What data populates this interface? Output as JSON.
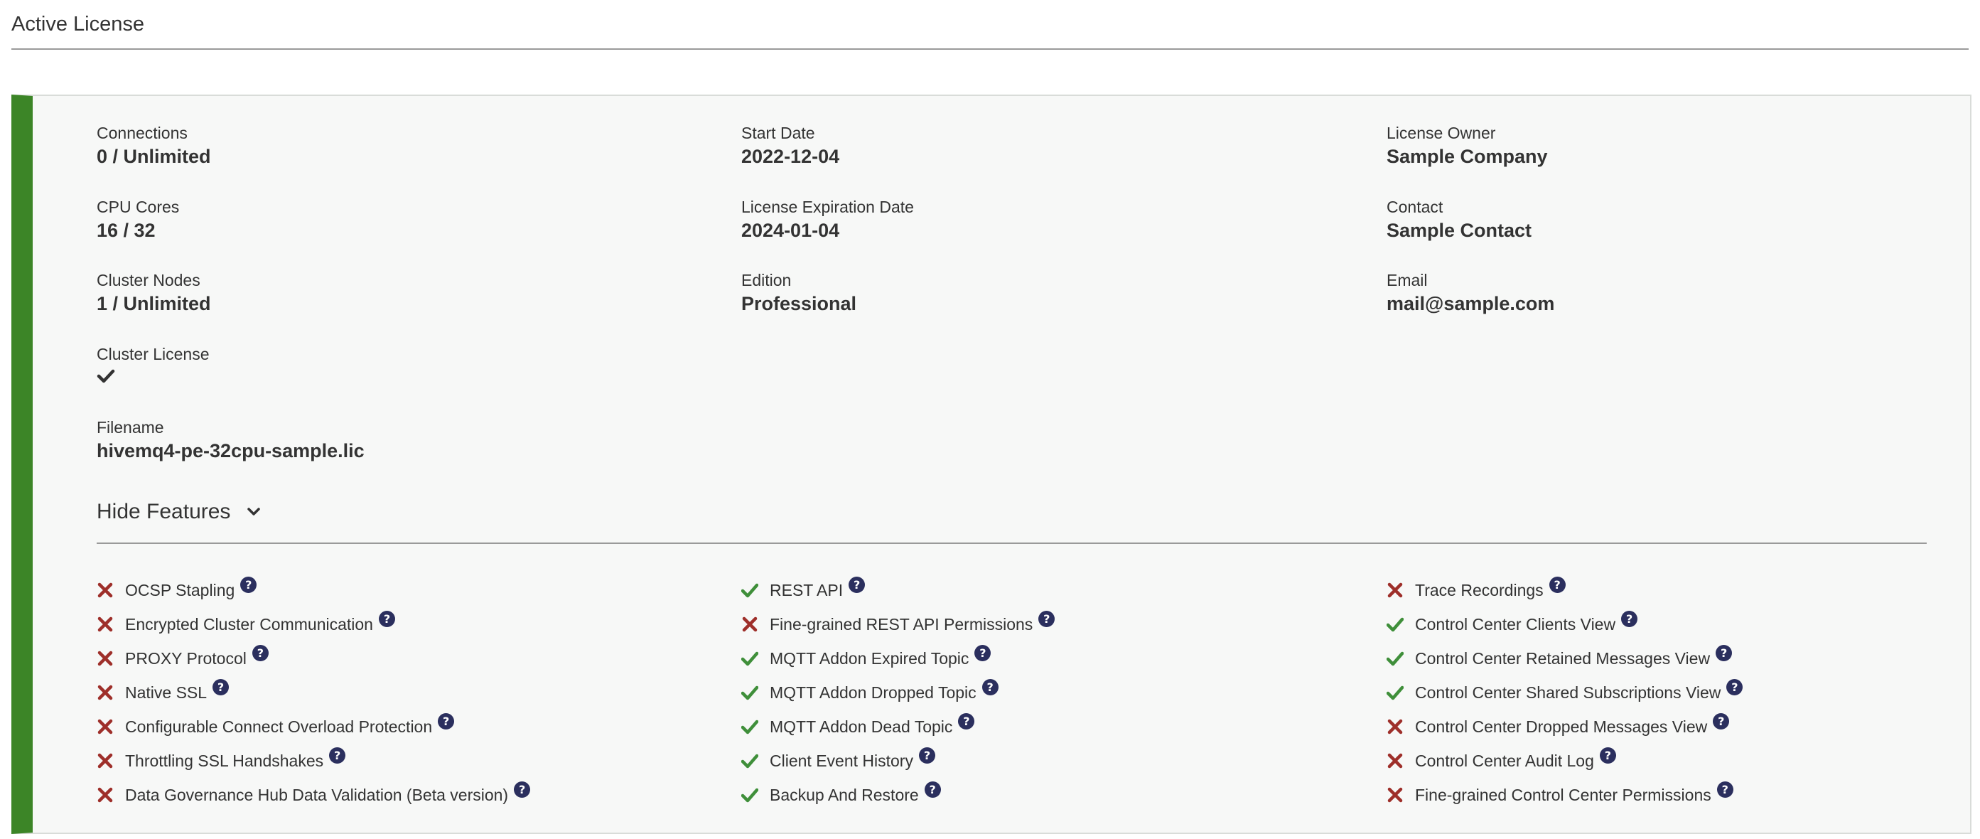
{
  "page": {
    "title": "Active License"
  },
  "license": {
    "col1": [
      {
        "label": "Connections",
        "value": "0 / Unlimited"
      },
      {
        "label": "CPU Cores",
        "value": "16 / 32"
      },
      {
        "label": "Cluster Nodes",
        "value": "1 / Unlimited"
      },
      {
        "label": "Cluster License",
        "value": "check"
      },
      {
        "label": "Filename",
        "value": "hivemq4-pe-32cpu-sample.lic"
      }
    ],
    "col2": [
      {
        "label": "Start Date",
        "value": "2022-12-04"
      },
      {
        "label": "License Expiration Date",
        "value": "2024-01-04"
      },
      {
        "label": "Edition",
        "value": "Professional"
      }
    ],
    "col3": [
      {
        "label": "License Owner",
        "value": "Sample Company"
      },
      {
        "label": "Contact",
        "value": "Sample Contact"
      },
      {
        "label": "Email",
        "value": "mail@sample.com"
      }
    ]
  },
  "features_toggle": {
    "label": "Hide Features",
    "icon": "chevron-down-icon"
  },
  "features": {
    "col1": [
      {
        "name": "OCSP Stapling",
        "enabled": false
      },
      {
        "name": "Encrypted Cluster Communication",
        "enabled": false
      },
      {
        "name": "PROXY Protocol",
        "enabled": false
      },
      {
        "name": "Native SSL",
        "enabled": false
      },
      {
        "name": "Configurable Connect Overload Protection",
        "enabled": false
      },
      {
        "name": "Throttling SSL Handshakes",
        "enabled": false
      },
      {
        "name": "Data Governance Hub Data Validation (Beta version)",
        "enabled": false
      }
    ],
    "col2": [
      {
        "name": "REST API",
        "enabled": true
      },
      {
        "name": "Fine-grained REST API Permissions",
        "enabled": false
      },
      {
        "name": "MQTT Addon Expired Topic",
        "enabled": true
      },
      {
        "name": "MQTT Addon Dropped Topic",
        "enabled": true
      },
      {
        "name": "MQTT Addon Dead Topic",
        "enabled": true
      },
      {
        "name": "Client Event History",
        "enabled": true
      },
      {
        "name": "Backup And Restore",
        "enabled": true
      }
    ],
    "col3": [
      {
        "name": "Trace Recordings",
        "enabled": false
      },
      {
        "name": "Control Center Clients View",
        "enabled": true
      },
      {
        "name": "Control Center Retained Messages View",
        "enabled": true
      },
      {
        "name": "Control Center Shared Subscriptions View",
        "enabled": true
      },
      {
        "name": "Control Center Dropped Messages View",
        "enabled": false
      },
      {
        "name": "Control Center Audit Log",
        "enabled": false
      },
      {
        "name": "Fine-grained Control Center Permissions",
        "enabled": false
      }
    ]
  },
  "colors": {
    "accent_bar": "#3c8527",
    "enabled": "#3f8f3a",
    "disabled": "#9e2f2a",
    "help_icon_bg": "#2b2f5e"
  },
  "icons": {
    "enabled": "check-icon",
    "disabled": "x-icon",
    "help": "help-icon",
    "cluster_license": "check-icon"
  }
}
